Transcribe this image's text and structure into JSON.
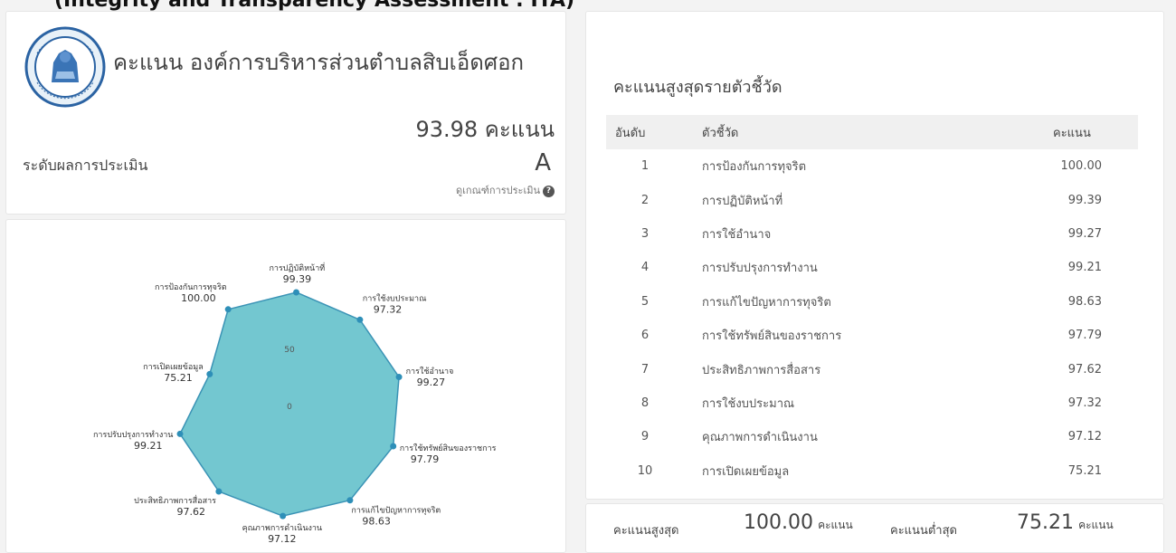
{
  "header_clip": "(Integrity and Transparency Assessment : ITA)",
  "org": {
    "title": "คะแนน องค์การบริหารส่วนตำบลสิบเอ็ดศอก",
    "total_score": "93.98 คะแนน",
    "level_label": "ระดับผลการประเมิน",
    "level_value": "A",
    "criteria_link": "ดูเกณฑ์การประเมิน",
    "seal_name": "seal-logo"
  },
  "colors": {
    "radar_fill": "#5bbdc8",
    "radar_stroke": "#3a93b5",
    "point": "#2e8fb8"
  },
  "chart_data": {
    "type": "radar",
    "scale_ticks": [
      0,
      50
    ],
    "axes": [
      {
        "label": "การปฏิบัติหน้าที่",
        "value": 99.39
      },
      {
        "label": "การใช้งบประมาณ",
        "value": 97.32
      },
      {
        "label": "การใช้อำนาจ",
        "value": 99.27
      },
      {
        "label": "การใช้ทรัพย์สินของราชการ",
        "value": 97.79
      },
      {
        "label": "การแก้ไขปัญหาการทุจริต",
        "value": 98.63
      },
      {
        "label": "คุณภาพการดำเนินงาน",
        "value": 97.12
      },
      {
        "label": "ประสิทธิภาพการสื่อสาร",
        "value": 97.62
      },
      {
        "label": "การปรับปรุงการทำงาน",
        "value": 99.21
      },
      {
        "label": "การเปิดเผยข้อมูล",
        "value": 75.21
      },
      {
        "label": "การป้องกันการทุจริต",
        "value": 100.0
      }
    ]
  },
  "ranking": {
    "title": "คะแนนสูงสุดรายตัวชี้วัด",
    "headers": {
      "rank": "อันดับ",
      "indicator": "ตัวชี้วัด",
      "score": "คะแนน"
    },
    "rows": [
      {
        "rank": "1",
        "indicator": "การป้องกันการทุจริต",
        "score": "100.00"
      },
      {
        "rank": "2",
        "indicator": "การปฏิบัติหน้าที่",
        "score": "99.39"
      },
      {
        "rank": "3",
        "indicator": "การใช้อำนาจ",
        "score": "99.27"
      },
      {
        "rank": "4",
        "indicator": "การปรับปรุงการทำงาน",
        "score": "99.21"
      },
      {
        "rank": "5",
        "indicator": "การแก้ไขปัญหาการทุจริต",
        "score": "98.63"
      },
      {
        "rank": "6",
        "indicator": "การใช้ทรัพย์สินของราชการ",
        "score": "97.79"
      },
      {
        "rank": "7",
        "indicator": "ประสิทธิภาพการสื่อสาร",
        "score": "97.62"
      },
      {
        "rank": "8",
        "indicator": "การใช้งบประมาณ",
        "score": "97.32"
      },
      {
        "rank": "9",
        "indicator": "คุณภาพการดำเนินงาน",
        "score": "97.12"
      },
      {
        "rank": "10",
        "indicator": "การเปิดเผยข้อมูล",
        "score": "75.21"
      }
    ]
  },
  "minmax": {
    "max_label": "คะแนนสูงสุด",
    "max_value": "100.00",
    "max_unit": "คะแนน",
    "min_label": "คะแนนต่ำสุด",
    "min_value": "75.21",
    "min_unit": "คะแนน"
  }
}
